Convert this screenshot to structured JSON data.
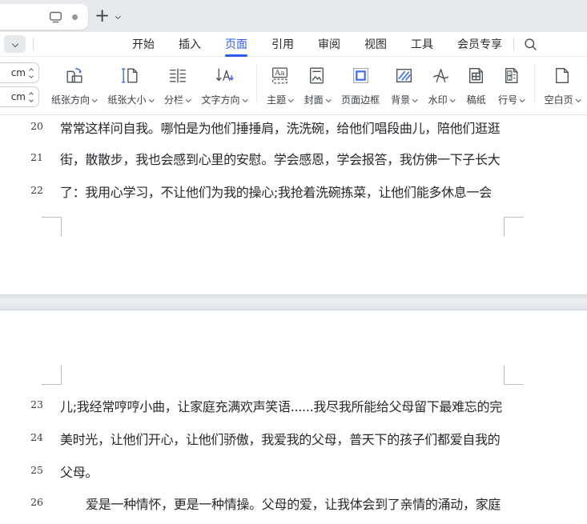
{
  "colors": {
    "accent_blue": "#2e5af2",
    "icon_gray": "#4a5056",
    "tabbar_bg": "#e7e9ec"
  },
  "tab_bar": {
    "new_tab_label": "+",
    "tab_icons": [
      "monitor-icon",
      "dot-icon"
    ]
  },
  "menu_bar": {
    "items": [
      {
        "label": "开始",
        "active": false
      },
      {
        "label": "插入",
        "active": false
      },
      {
        "label": "页面",
        "active": true
      },
      {
        "label": "引用",
        "active": false
      },
      {
        "label": "审阅",
        "active": false
      },
      {
        "label": "视图",
        "active": false
      },
      {
        "label": "工具",
        "active": false
      },
      {
        "label": "会员专享",
        "active": false
      }
    ],
    "search_icon": "search-icon"
  },
  "toolbar": {
    "spinners": [
      {
        "value": "cm"
      },
      {
        "value": "cm"
      }
    ],
    "buttons": [
      {
        "label": "纸张方向",
        "icon": "paper-orientation-icon",
        "has_dropdown": true
      },
      {
        "label": "纸张大小",
        "icon": "paper-size-icon",
        "has_dropdown": true
      },
      {
        "label": "分栏",
        "icon": "columns-icon",
        "has_dropdown": true
      },
      {
        "label": "文字方向",
        "icon": "text-direction-icon",
        "has_dropdown": true
      },
      {
        "label": "主题",
        "icon": "theme-icon",
        "has_dropdown": true
      },
      {
        "label": "封面",
        "icon": "cover-icon",
        "has_dropdown": true
      },
      {
        "label": "页面边框",
        "icon": "page-border-icon",
        "has_dropdown": false
      },
      {
        "label": "背景",
        "icon": "background-icon",
        "has_dropdown": true
      },
      {
        "label": "水印",
        "icon": "watermark-icon",
        "has_dropdown": true
      },
      {
        "label": "稿纸",
        "icon": "manuscript-paper-icon",
        "has_dropdown": false
      },
      {
        "label": "行号",
        "icon": "line-number-icon",
        "has_dropdown": true
      },
      {
        "label": "空白页",
        "icon": "blank-page-icon",
        "has_dropdown": true
      }
    ]
  },
  "document": {
    "page1_lines": [
      {
        "num": "20",
        "text": "常常这样问自我。哪怕是为他们捶捶肩，洗洗碗，给他们唱段曲儿，陪他们逛逛"
      },
      {
        "num": "21",
        "text": "街，散散步，我也会感到心里的安慰。学会感恩，学会报答，我仿佛一下子长大"
      },
      {
        "num": "22",
        "text": "了：我用心学习，不让他们为我的操心;我抢着洗碗拣菜，让他们能多休息一会"
      }
    ],
    "page2_lines": [
      {
        "num": "23",
        "text": "儿;我经常哼哼小曲，让家庭充满欢声笑语......我尽我所能给父母留下最难忘的完"
      },
      {
        "num": "24",
        "text": "美时光，让他们开心，让他们骄傲，我爱我的父母，普天下的孩子们都爱自我的"
      },
      {
        "num": "25",
        "text": "父母。"
      },
      {
        "num": "26",
        "text": "爱是一种情怀，更是一种情操。父母的爱，让我体会到了亲情的涌动，家庭",
        "indent": true
      }
    ]
  }
}
